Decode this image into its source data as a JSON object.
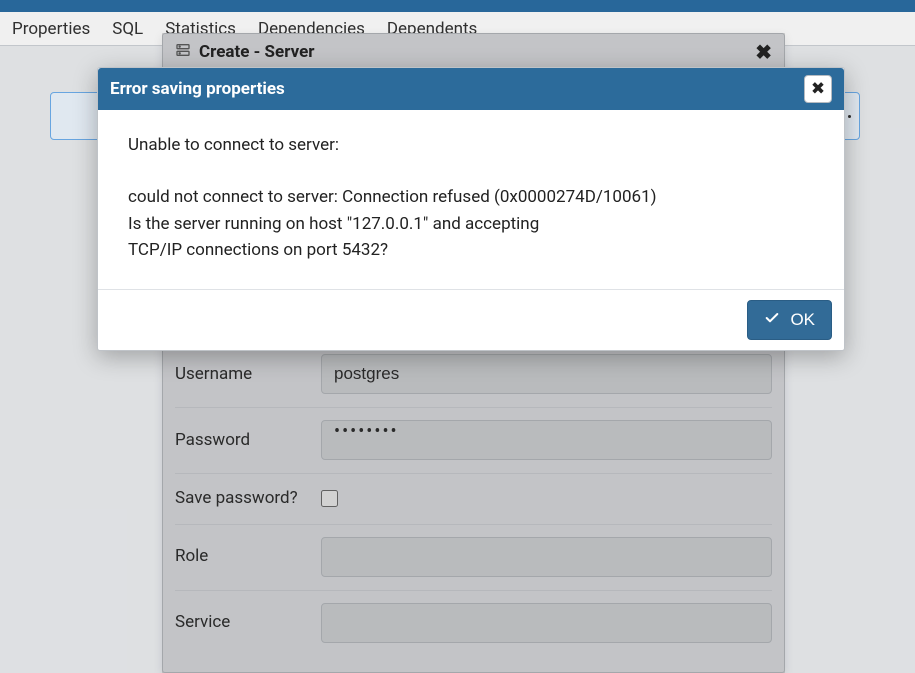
{
  "tabs": {
    "properties": "Properties",
    "sql": "SQL",
    "statistics": "Statistics",
    "dependencies": "Dependencies",
    "dependents": "Dependents"
  },
  "create_dialog": {
    "title": "Create - Server",
    "icon": "server-icon",
    "fields": {
      "username_label": "Username",
      "username_value": "postgres",
      "password_label": "Password",
      "password_value": "••••••••",
      "save_password_label": "Save password?",
      "save_password_checked": false,
      "role_label": "Role",
      "role_value": "",
      "service_label": "Service",
      "service_value": ""
    }
  },
  "error_dialog": {
    "title": "Error saving properties",
    "body_lead": "Unable to connect to server:",
    "body_line1": "could not connect to server: Connection refused (0x0000274D/10061)",
    "body_line2": "Is the server running on host \"127.0.0.1\" and accepting",
    "body_line3": "TCP/IP connections on port 5432?",
    "ok_label": "OK"
  }
}
